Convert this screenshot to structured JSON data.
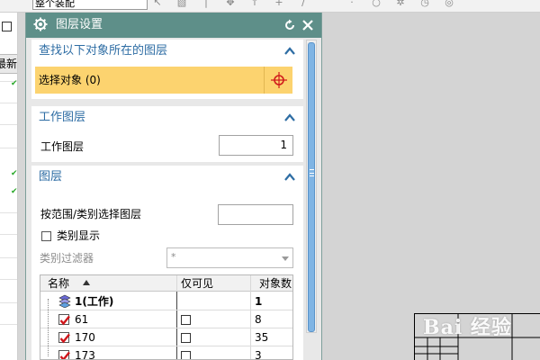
{
  "toolbar": {
    "combo_value": "整个装配",
    "tool_icons": [
      "cursor-icon",
      "block-icon",
      "line-icon",
      "snap-icon",
      "arrow-icon",
      "plus-icon",
      "curve-icon",
      "arc-icon",
      "point-icon",
      "circle-icon",
      "gear-small-icon",
      "clock-icon",
      "target-icon"
    ]
  },
  "left_strip": {
    "new_button": "最新"
  },
  "dialog": {
    "title": "图层设置",
    "sections": {
      "find": {
        "title": "查找以下对象所在的图层",
        "select_label": "选择对象 (0)"
      },
      "work_layer": {
        "title": "工作图层",
        "label": "工作图层",
        "value": "1"
      },
      "layers": {
        "title": "图层",
        "range_label": "按范围/类别选择图层",
        "range_value": "",
        "category_display_label": "类别显示",
        "category_display_checked": false,
        "category_filter_label": "类别过滤器",
        "category_filter_value": "*",
        "columns": [
          "名称",
          "仅可见",
          "对象数"
        ],
        "rows": [
          {
            "name": "1(工作)",
            "count": "1",
            "work": true
          },
          {
            "name": "61",
            "count": "8",
            "checked": true
          },
          {
            "name": "170",
            "count": "35",
            "checked": true
          },
          {
            "name": "173",
            "count": "3",
            "checked": true
          }
        ]
      }
    }
  },
  "colors": {
    "titlebar": "#5e8f89",
    "section_title": "#2e6da4",
    "selection_highlight": "#fcd36f",
    "scroll_thumb": "#7fb4e4"
  },
  "watermark": "Bai 经验"
}
